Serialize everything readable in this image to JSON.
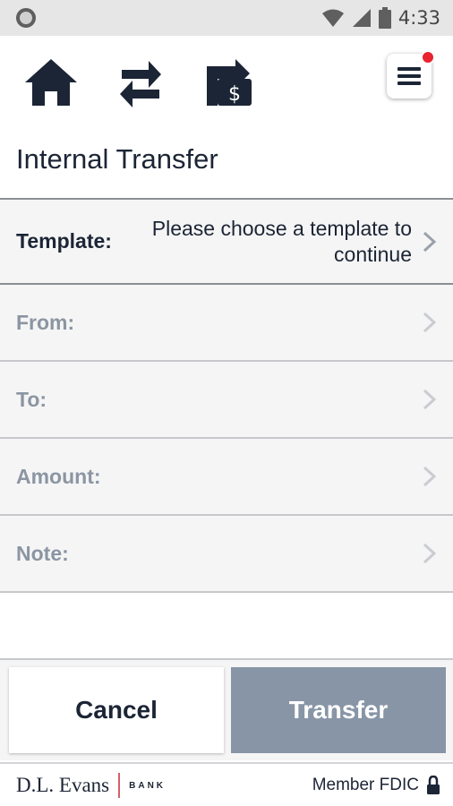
{
  "status_bar": {
    "time": "4:33",
    "icons": [
      "notification-circle-icon",
      "wifi-icon",
      "signal-icon",
      "battery-icon"
    ]
  },
  "nav": {
    "icons": [
      "home-icon",
      "transfer-arrows-icon",
      "bill-pay-icon",
      "menu-icon"
    ],
    "menu_has_notification": true
  },
  "page": {
    "title": "Internal Transfer"
  },
  "form": {
    "template": {
      "label": "Template:",
      "value": "Please choose a template to continue"
    },
    "from": {
      "label": "From:",
      "value": ""
    },
    "to": {
      "label": "To:",
      "value": ""
    },
    "amount": {
      "label": "Amount:",
      "value": ""
    },
    "note": {
      "label": "Note:",
      "value": ""
    }
  },
  "actions": {
    "cancel_label": "Cancel",
    "transfer_label": "Transfer"
  },
  "footer": {
    "logo_name": "D.L. Evans",
    "logo_bank": "BANK",
    "member_text": "Member FDIC"
  },
  "colors": {
    "navy": "#1c2535",
    "muted_label": "#8b95a3",
    "transfer_disabled": "#8895a6",
    "notification_dot": "#e9232f",
    "logo_accent": "#d2616a"
  }
}
